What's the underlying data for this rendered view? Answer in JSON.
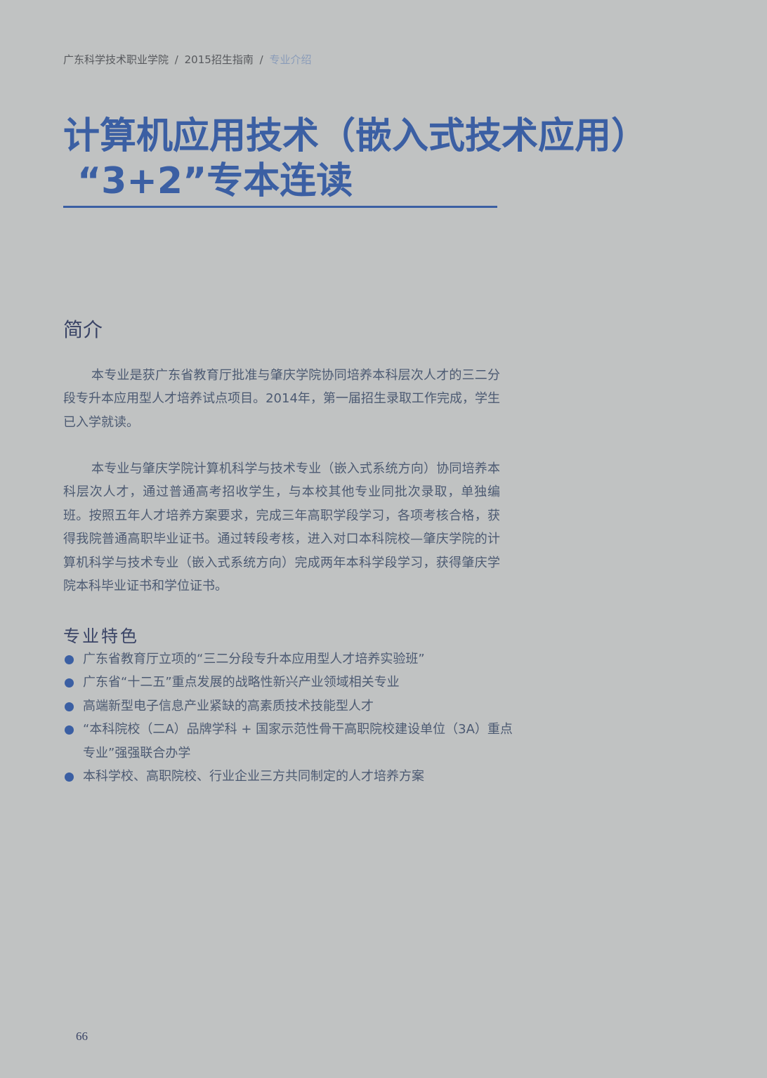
{
  "breadcrumb": {
    "school": "广东科学技术职业学院",
    "guide": "2015招生指南",
    "section": "专业介绍",
    "separator": "/"
  },
  "title": {
    "line1": "计算机应用技术（嵌入式技术应用）",
    "line2": "“3+2”专本连读"
  },
  "intro": {
    "heading": "简介",
    "paragraphs": [
      "本专业是获广东省教育厅批准与肇庆学院协同培养本科层次人才的三二分段专升本应用型人才培养试点项目。2014年，第一届招生录取工作完成，学生已入学就读。",
      "本专业与肇庆学院计算机科学与技术专业（嵌入式系统方向）协同培养本科层次人才，通过普通高考招收学生，与本校其他专业同批次录取，单独编班。按照五年人才培养方案要求，完成三年高职学段学习，各项考核合格，获得我院普通高职毕业证书。通过转段考核，进入对口本科院校—肇庆学院的计算机科学与技术专业（嵌入式系统方向）完成两年本科学段学习，获得肇庆学院本科毕业证书和学位证书。"
    ]
  },
  "features": {
    "heading": "专业特色",
    "items": [
      "广东省教育厅立项的“三二分段专升本应用型人才培养实验班”",
      "广东省“十二五”重点发展的战略性新兴产业领域相关专业",
      "高端新型电子信息产业紧缺的高素质技术技能型人才",
      "“本科院校（二A）品牌学科 + 国家示范性骨干高职院校建设单位（3A）重点专业”强强联合办学",
      "本科学校、高职院校、行业企业三方共同制定的人才培养方案"
    ]
  },
  "page_number": "66",
  "colors": {
    "background": "#c0c2c2",
    "accent_blue": "#3b5fa3",
    "body_text": "#4c5a72"
  }
}
